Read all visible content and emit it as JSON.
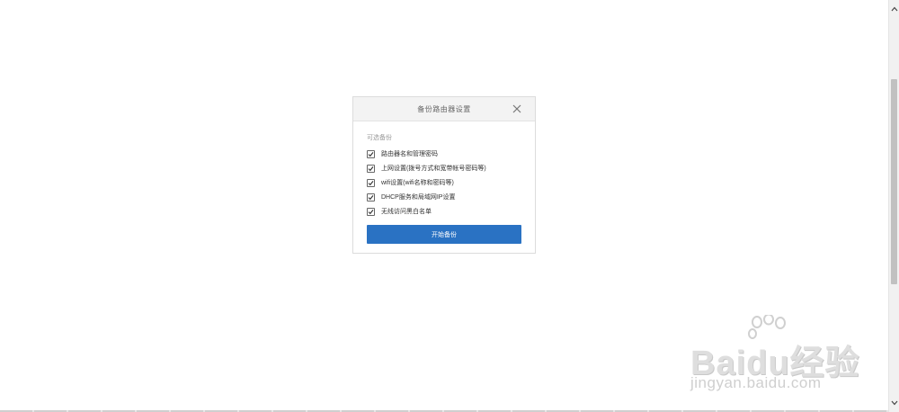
{
  "dialog": {
    "title": "备份路由器设置",
    "section_label": "可选备份",
    "options": [
      {
        "label": "路由器名和管理密码",
        "checked": true
      },
      {
        "label": "上网设置(拨号方式和宽带帐号密码等)",
        "checked": true
      },
      {
        "label": "wifi设置(wifi名称和密码等)",
        "checked": true
      },
      {
        "label": "DHCP服务和局域网IP设置",
        "checked": true
      },
      {
        "label": "无线访问黑白名单",
        "checked": true
      }
    ],
    "start_button_label": "开始备份"
  },
  "watermark": {
    "brand": "Baidu经验",
    "url": "jingyan.baidu.com"
  },
  "colors": {
    "accent": "#2a72c3",
    "header_bg": "#f3f3f3"
  }
}
